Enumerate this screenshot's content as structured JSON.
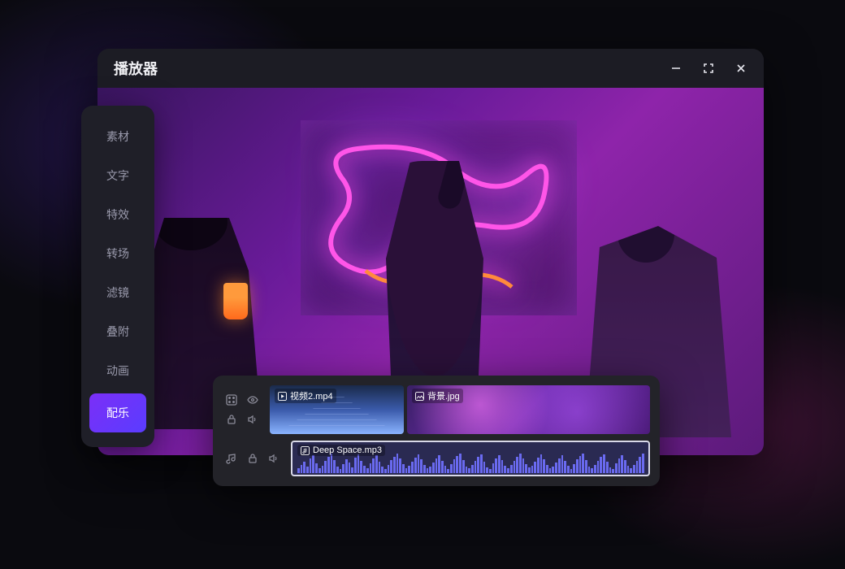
{
  "window": {
    "title": "播放器"
  },
  "sidebar": {
    "items": [
      {
        "label": "素材"
      },
      {
        "label": "文字"
      },
      {
        "label": "特效"
      },
      {
        "label": "转场"
      },
      {
        "label": "滤镜"
      },
      {
        "label": "叠附"
      },
      {
        "label": "动画"
      },
      {
        "label": "配乐"
      }
    ],
    "active_index": 7
  },
  "timeline": {
    "video_clips": [
      {
        "label": "视频2.mp4",
        "type": "video"
      },
      {
        "label": "背景.jpg",
        "type": "image"
      }
    ],
    "audio_clip": {
      "label": "Deep Space.mp3"
    }
  }
}
